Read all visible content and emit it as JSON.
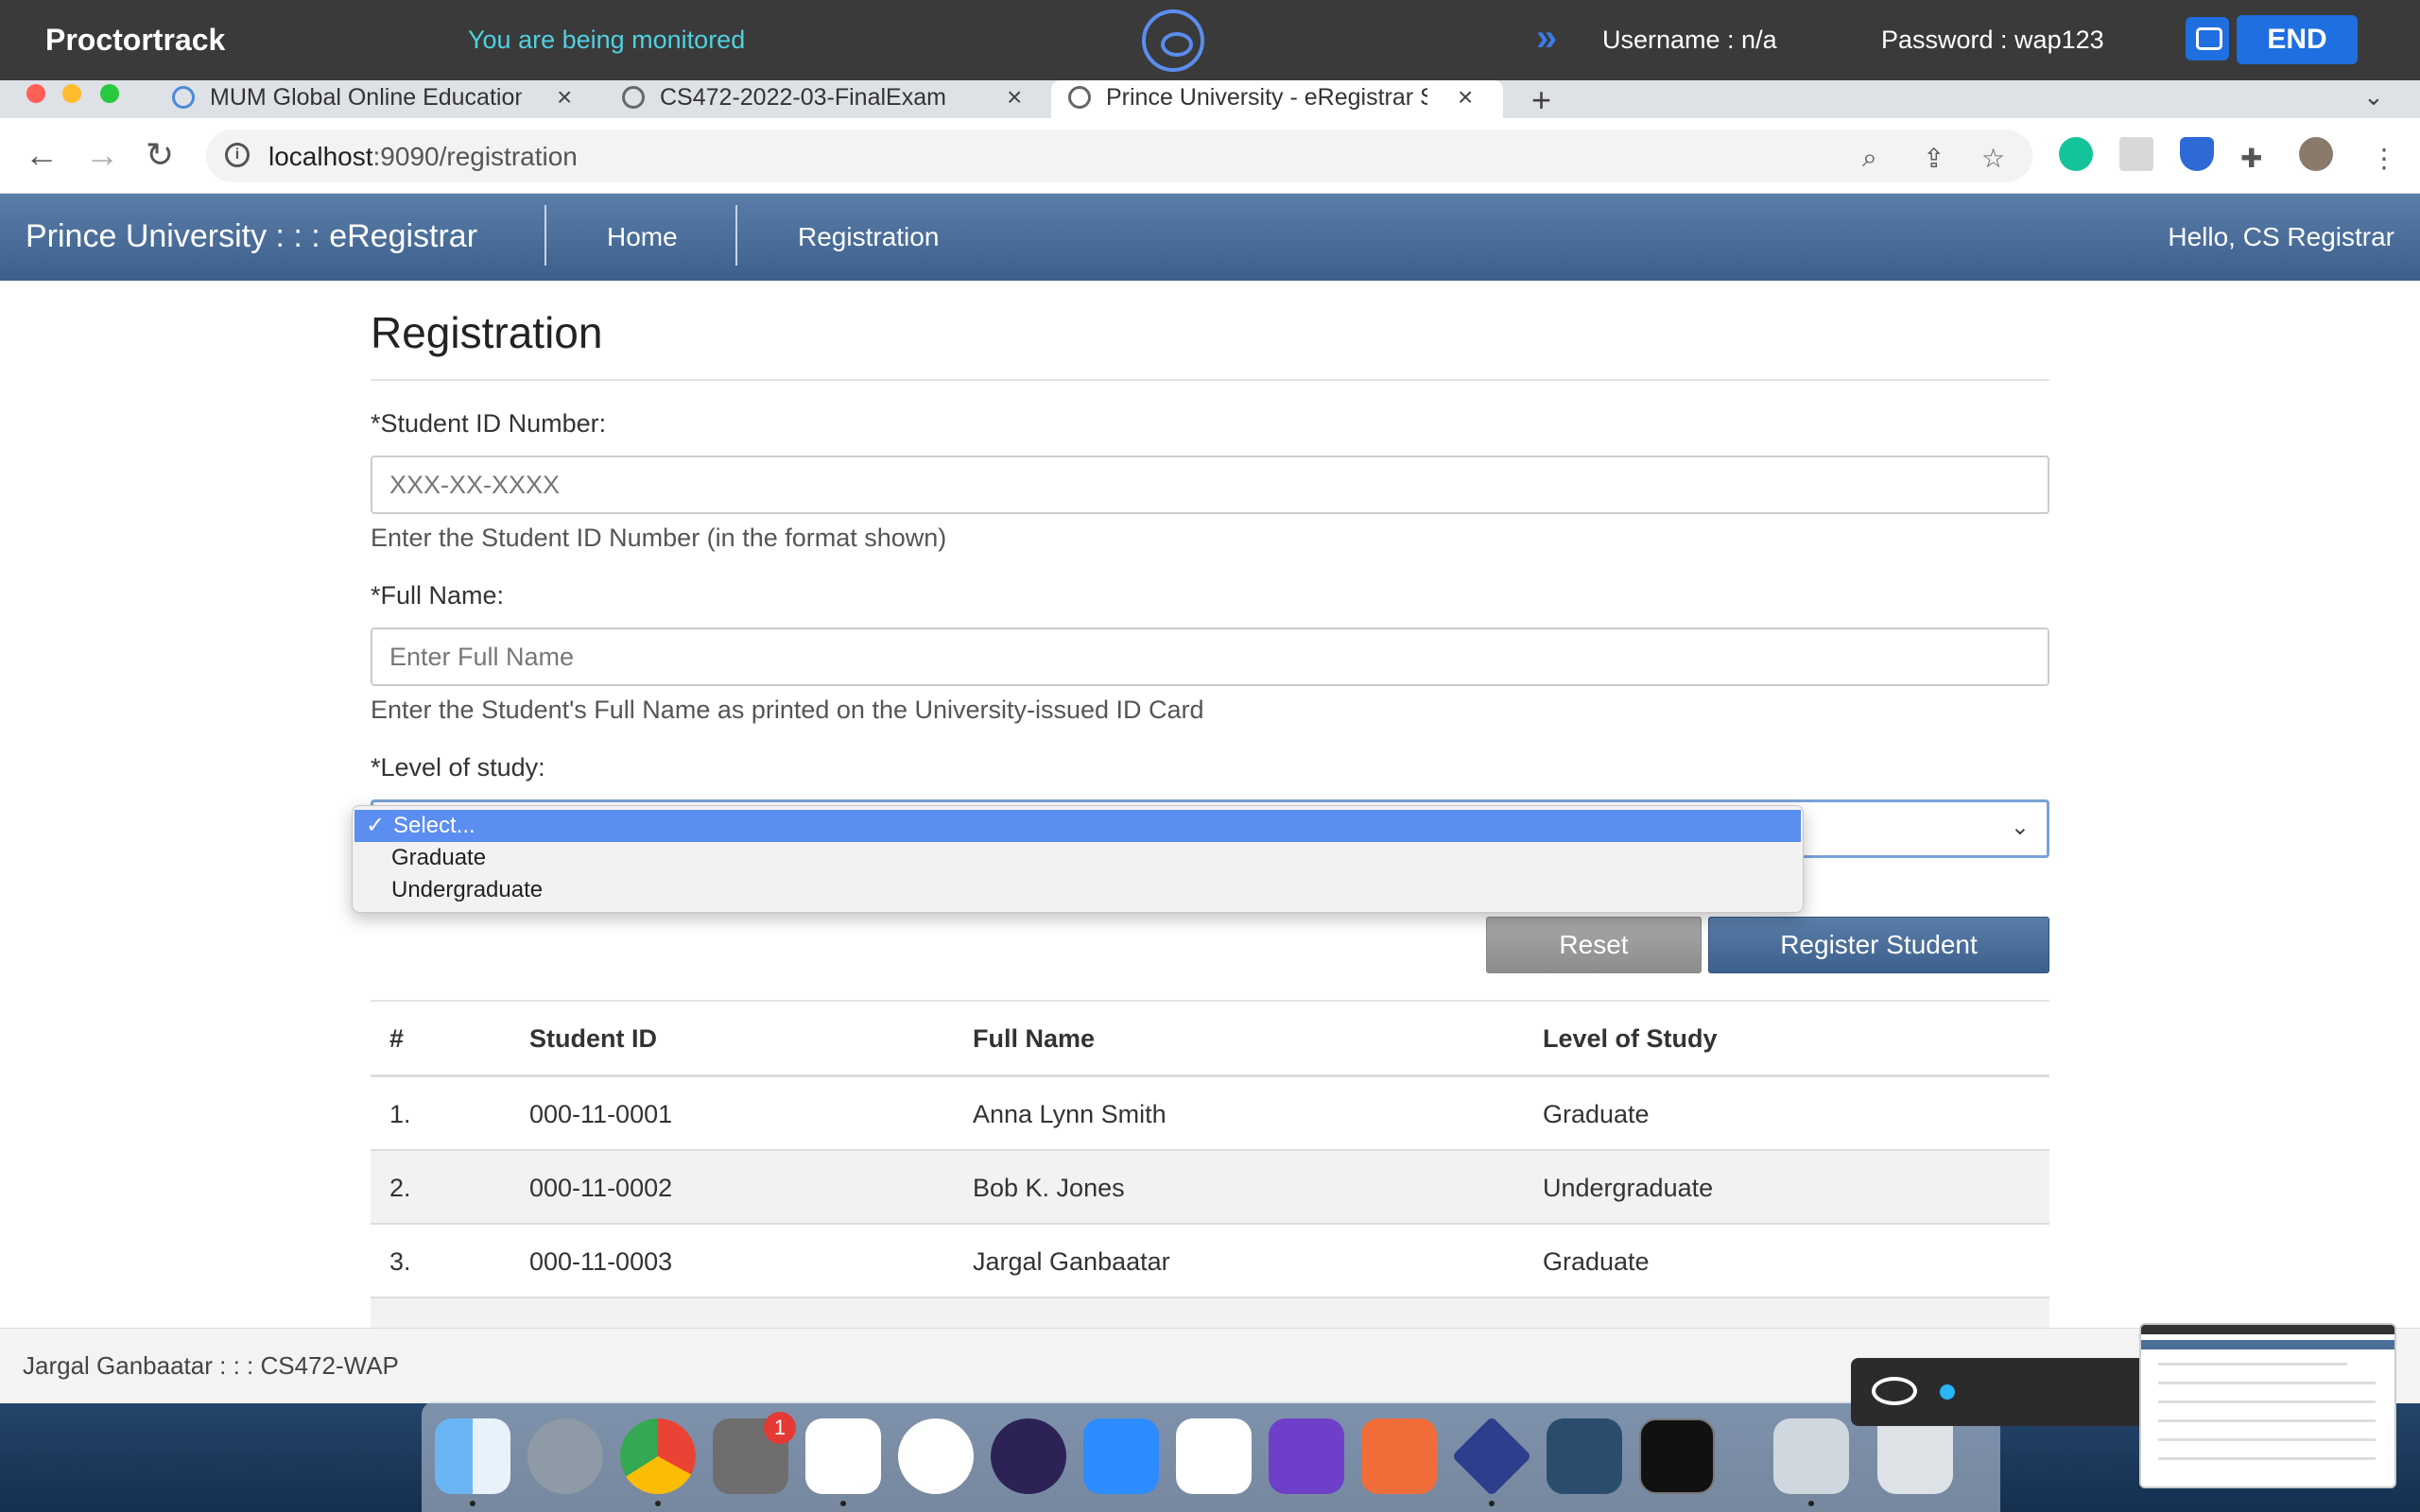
{
  "proctor": {
    "brand": "Proctortrack",
    "monitored": "You are being monitored",
    "username": "Username : n/a",
    "password": "Password : wap123",
    "end_label": "END"
  },
  "browser": {
    "tabs": [
      {
        "label": "MUM Global Online Education :"
      },
      {
        "label": "CS472-2022-03-FinalExam"
      },
      {
        "label": "Prince University - eRegistrar S"
      }
    ],
    "url_host": "localhost",
    "url_rest": ":9090/registration"
  },
  "app": {
    "brand": "Prince University : : : eRegistrar",
    "nav": [
      "Home",
      "Registration"
    ],
    "greeting": "Hello, CS Registrar"
  },
  "form": {
    "title": "Registration",
    "student_id_label": "*Student ID Number:",
    "student_id_placeholder": "XXX-XX-XXXX",
    "student_id_help": "Enter the Student ID Number (in the format shown)",
    "full_name_label": "*Full Name:",
    "full_name_placeholder": "Enter Full Name",
    "full_name_help": "Enter the Student's Full Name as printed on the University-issued ID Card",
    "level_label": "*Level of study:",
    "level_options": [
      "Select...",
      "Graduate",
      "Undergraduate"
    ],
    "level_selected": "Select...",
    "reset_label": "Reset",
    "register_label": "Register Student"
  },
  "table": {
    "headers": [
      "#",
      "Student ID",
      "Full Name",
      "Level of Study"
    ],
    "rows": [
      [
        "1.",
        "000-11-0001",
        "Anna Lynn Smith",
        "Graduate"
      ],
      [
        "2.",
        "000-11-0002",
        "Bob K. Jones",
        "Undergraduate"
      ],
      [
        "3.",
        "000-11-0003",
        "Jargal Ganbaatar",
        "Graduate"
      ]
    ]
  },
  "footer": {
    "text": "Jargal Ganbaatar : : : CS472-WAP"
  },
  "dock": {
    "badge": "1",
    "icons": [
      "finder-icon",
      "launchpad-icon",
      "chrome-icon",
      "system-preferences-icon",
      "vscode-icon",
      "xcode-icon",
      "eclipse-icon",
      "zoom-icon",
      "teams-icon",
      "github-desktop-icon",
      "postman-icon",
      "proctortrack-icon",
      "mysql-workbench-icon",
      "terminal-icon",
      "preview-icon",
      "trash-icon"
    ]
  },
  "colors": {
    "nav_bar": "#3c5f8c",
    "select_highlight": "#5b8ef0",
    "proctor_end": "#1f6fe0",
    "monitored_text": "#4fd1e0"
  }
}
